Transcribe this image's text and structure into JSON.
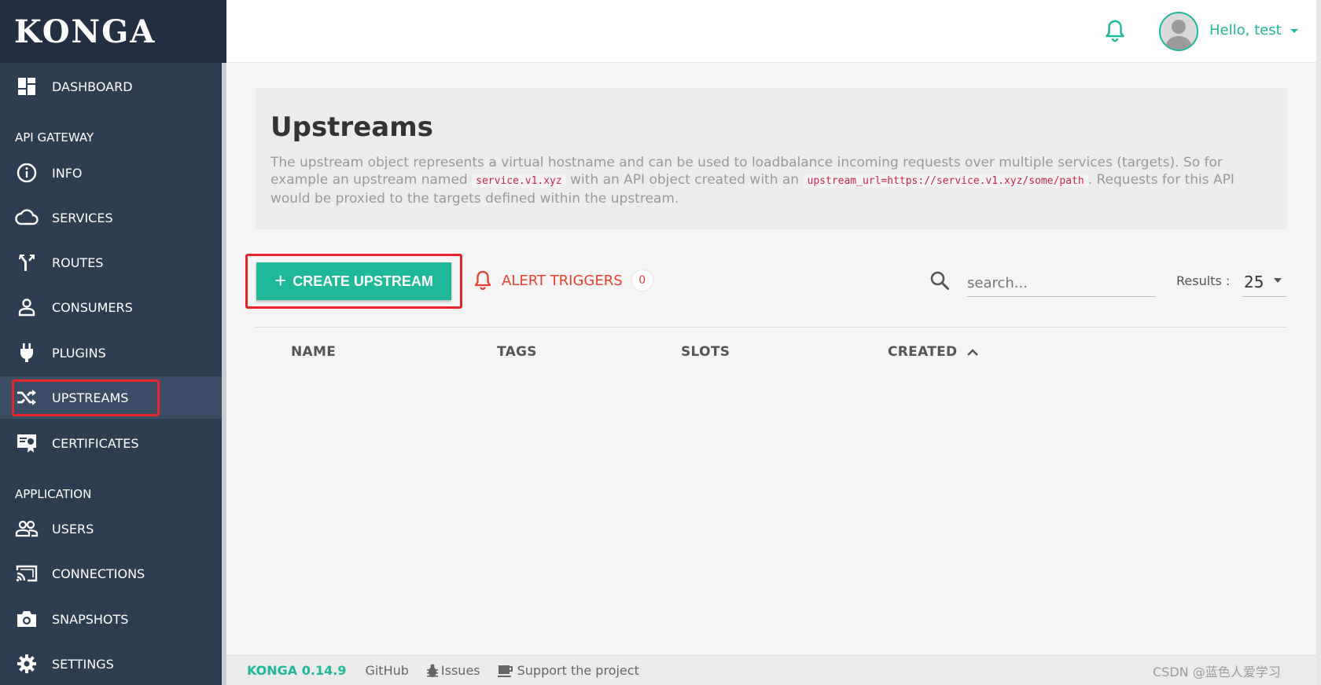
{
  "brand": {
    "logo_text": "KONGA"
  },
  "sidebar": {
    "dashboard": "DASHBOARD",
    "section_api": "API GATEWAY",
    "api_items": [
      {
        "label": "INFO",
        "icon": "info-icon"
      },
      {
        "label": "SERVICES",
        "icon": "cloud-icon"
      },
      {
        "label": "ROUTES",
        "icon": "routes-icon"
      },
      {
        "label": "CONSUMERS",
        "icon": "user-icon"
      },
      {
        "label": "PLUGINS",
        "icon": "plug-icon"
      },
      {
        "label": "UPSTREAMS",
        "icon": "shuffle-icon"
      },
      {
        "label": "CERTIFICATES",
        "icon": "certificate-icon"
      }
    ],
    "section_app": "APPLICATION",
    "app_items": [
      {
        "label": "USERS",
        "icon": "users-icon"
      },
      {
        "label": "CONNECTIONS",
        "icon": "cast-icon"
      },
      {
        "label": "SNAPSHOTS",
        "icon": "camera-icon"
      },
      {
        "label": "SETTINGS",
        "icon": "gear-icon"
      }
    ]
  },
  "topbar": {
    "greeting": "Hello, test"
  },
  "hero": {
    "title": "Upstreams",
    "desc_part1": "The upstream object represents a virtual hostname and can be used to loadbalance incoming requests over multiple services (targets). So for example an upstream named",
    "code1": "service.v1.xyz",
    "desc_part2": "with an API object created with an",
    "code2": "upstream_url=https://service.v1.xyz/some/path",
    "desc_part3": ". Requests for this API would be proxied to the targets defined within the upstream."
  },
  "toolbar": {
    "create_label": "CREATE UPSTREAM",
    "alert_label": "ALERT TRIGGERS",
    "alert_count": "0",
    "search_placeholder": "search...",
    "results_label": "Results :",
    "results_value": "25"
  },
  "table": {
    "columns": [
      "NAME",
      "TAGS",
      "SLOTS",
      "CREATED"
    ]
  },
  "footer": {
    "version": "KONGA 0.14.9",
    "github": "GitHub",
    "issues": "Issues",
    "support": "Support the project",
    "watermark": "CSDN @蓝色人爱学习"
  },
  "colors": {
    "accent": "#1fb89a",
    "sidebar": "#2e3e52",
    "alert": "#e8402f",
    "highlight": "#e8232a"
  }
}
